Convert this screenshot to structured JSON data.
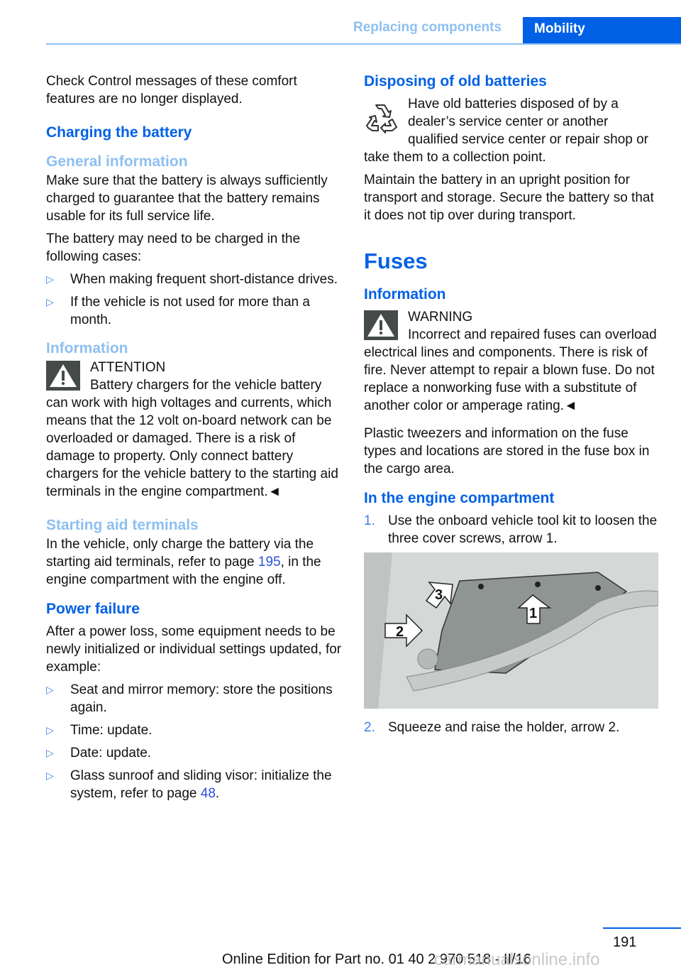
{
  "header": {
    "section": "Replacing components",
    "chapter": "Mobility"
  },
  "left": {
    "intro": "Check Control messages of these comfort features are no longer displayed.",
    "charging_heading": "Charging the battery",
    "general_heading": "General information",
    "general_p1": "Make sure that the battery is always sufficiently charged to guarantee that the battery remains usable for its full service life.",
    "general_p2": "The battery may need to be charged in the following cases:",
    "cases": [
      "When making frequent short-distance drives.",
      "If the vehicle is not used for more than a month."
    ],
    "info_heading": "Information",
    "attention_label": "ATTENTION",
    "attention_text": "Battery chargers for the vehicle battery can work with high voltages and currents, which means that the 12 volt on-board network can be overloaded or damaged. There is a risk of damage to property. Only connect battery chargers for the vehicle battery to the starting aid terminals in the engine compartment.◄",
    "terminals_heading": "Starting aid terminals",
    "terminals_pre": "In the vehicle, only charge the battery via the starting aid terminals, refer to page ",
    "terminals_link": "195",
    "terminals_post": ", in the engine compartment with the engine off.",
    "power_heading": "Power failure",
    "power_p": "After a power loss, some equipment needs to be newly initialized or individual settings updated, for example:",
    "power_items": [
      "Seat and mirror memory: store the positions again.",
      "Time: update.",
      "Date: update."
    ],
    "power_last_pre": "Glass sunroof and sliding visor: initialize the system, refer to page ",
    "power_last_link": "48",
    "power_last_post": "."
  },
  "right": {
    "disposing_heading": "Disposing of old batteries",
    "disposing_p1": "Have old batteries disposed of by a dealer’s service center or another qualified service center or repair shop or take them to a collection point.",
    "disposing_p2": "Maintain the battery in an upright position for transport and storage. Secure the battery so that it does not tip over during transport.",
    "fuses_heading": "Fuses",
    "info_heading": "Information",
    "warning_label": "WARNING",
    "warning_text": "Incorrect and repaired fuses can overload electrical lines and components. There is risk of fire. Never attempt to repair a blown fuse. Do not replace a nonworking fuse with a substitute of another color or amperage rating.◄",
    "tweezers_p": "Plastic tweezers and information on the fuse types and locations are stored in the fuse box in the cargo area.",
    "engine_heading": "In the engine compartment",
    "steps": [
      {
        "num": "1.",
        "text": "Use the onboard vehicle tool kit to loosen the three cover screws, arrow 1."
      },
      {
        "num": "2.",
        "text": "Squeeze and raise the holder, arrow 2."
      }
    ],
    "figure_arrows": [
      "1",
      "2",
      "3"
    ]
  },
  "footer": {
    "page_number": "191",
    "edition": "Online Edition for Part no. 01 40 2 970 518 - II/16",
    "watermark": "carmanualsonline.info"
  },
  "colors": {
    "primary_blue": "#0061e6",
    "light_blue": "#8ec0f0",
    "link_blue": "#2a4fe0"
  }
}
